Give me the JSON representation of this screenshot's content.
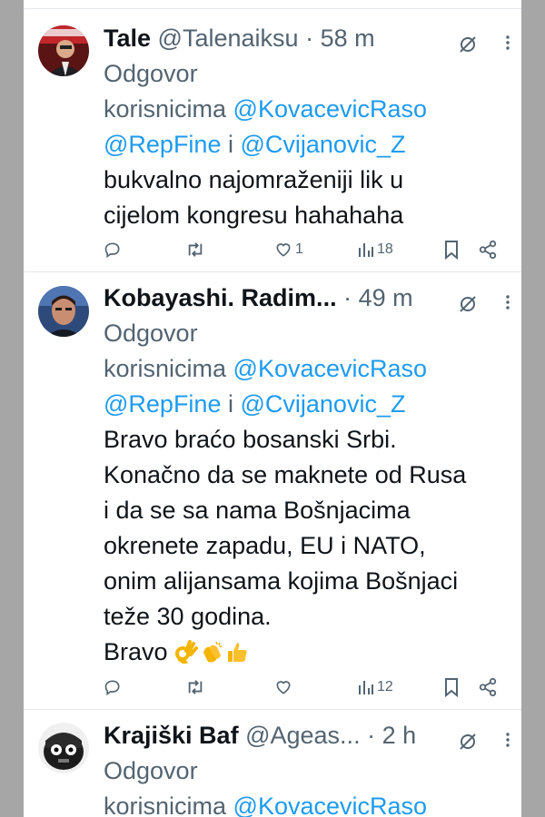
{
  "tweets": [
    {
      "name": "Tale",
      "handle": "@Talenaiksu",
      "sep": "·",
      "time": "58 m",
      "reply_prefix": "Odgovor",
      "reply_word": "korisnicima",
      "mention_1": "@KovacevicRaso",
      "mention_2": "@RepFine",
      "conj": "i",
      "mention_3": "@Cvijanovic_Z",
      "text_lines": [
        "bukvalno najomraženiji lik u",
        "cijelom kongresu hahahaha"
      ],
      "stats": {
        "replies": "",
        "reposts": "",
        "likes": "1",
        "views": "18"
      }
    },
    {
      "name": "Kobayashi. Radim...",
      "handle": "",
      "sep": "·",
      "time": "49 m",
      "reply_prefix": "Odgovor",
      "reply_word": "korisnicima",
      "mention_1": "@KovacevicRaso",
      "mention_2": "@RepFine",
      "conj": "i",
      "mention_3": "@Cvijanovic_Z",
      "text_lines": [
        "Bravo braćo bosanski Srbi.",
        "Konačno da se maknete od Rusa",
        "i da se sa nama Bošnjacima",
        "okrenete zapadu, EU i NATO,",
        "onim alijansama kojima Bošnjaci",
        "teže 30 godina.",
        "Bravo"
      ],
      "emojis": [
        "ok-hand-emoji",
        "clapping-hands-emoji",
        "thumbs-up-emoji"
      ],
      "stats": {
        "replies": "",
        "reposts": "",
        "likes": "",
        "views": "12"
      }
    },
    {
      "name": "Krajiški Baf",
      "handle": "@Ageas...",
      "sep": "·",
      "time": "2 h",
      "reply_prefix": "Odgovor",
      "reply_word": "korisnicima",
      "mention_1": "@KovacevicRaso"
    }
  ],
  "icons": {
    "reply": "reply-icon",
    "repost": "repost-icon",
    "like": "heart-icon",
    "views": "views-icon",
    "bookmark": "bookmark-icon",
    "share": "share-icon",
    "grok": "grok-icon",
    "more": "more-icon"
  },
  "colors": {
    "mention": "#1d9bf0",
    "muted": "#536471",
    "text": "#0f1419",
    "outer_background": "#a6a6a6"
  }
}
